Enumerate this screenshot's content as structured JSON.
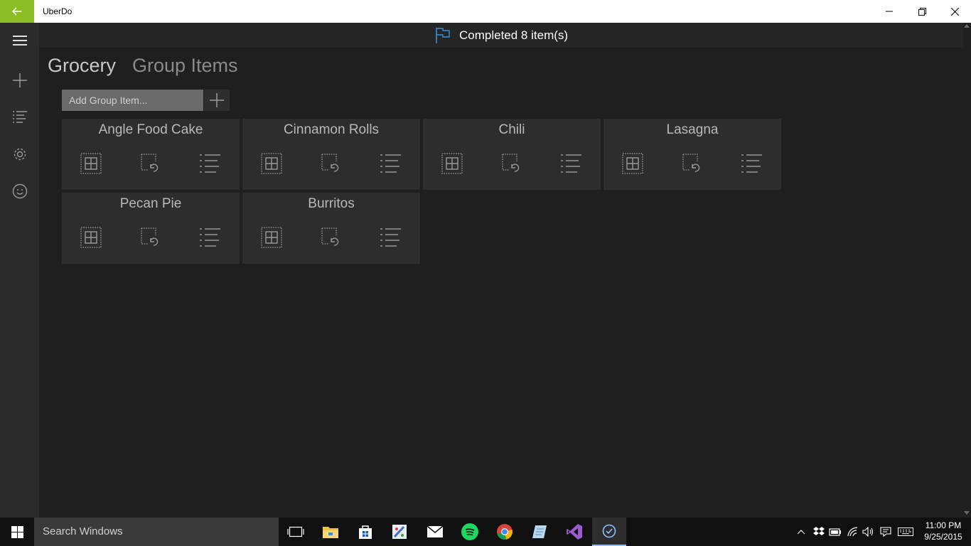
{
  "window": {
    "title": "UberDo",
    "back_icon": "back-arrow-icon",
    "controls": [
      "minimize-icon",
      "restore-icon",
      "close-icon"
    ]
  },
  "colors": {
    "accent_green": "#8cbf26",
    "flag_blue": "#3a8fd9",
    "background": "#1f1f1f",
    "sidebar": "#2b2b2b",
    "tile": "#2d2d2d"
  },
  "sidebar": {
    "items": [
      {
        "icon": "hamburger-menu-icon"
      },
      {
        "icon": "add-icon"
      },
      {
        "icon": "list-icon"
      },
      {
        "icon": "gear-icon"
      },
      {
        "icon": "smiley-icon"
      }
    ]
  },
  "status": {
    "icon": "flag-icon",
    "text": "Completed 8 item(s)"
  },
  "header": {
    "title": "Grocery",
    "subtitle": "Group Items"
  },
  "add_item": {
    "placeholder": "Add Group Item...",
    "button_icon": "plus-icon"
  },
  "groups": [
    {
      "name": "Angle Food Cake"
    },
    {
      "name": "Cinnamon Rolls"
    },
    {
      "name": "Chili"
    },
    {
      "name": "Lasagna"
    },
    {
      "name": "Pecan Pie"
    },
    {
      "name": "Burritos"
    }
  ],
  "tile_actions": [
    "grid-view-icon",
    "undo-select-icon",
    "list-view-icon"
  ],
  "taskbar": {
    "search_text": "Search Windows",
    "apps": [
      "task-view-icon",
      "file-explorer-icon",
      "store-icon",
      "paint-icon",
      "mail-icon",
      "spotify-icon",
      "chrome-icon",
      "notes-icon",
      "visual-studio-icon",
      "uberdo-icon"
    ],
    "tray": [
      "chevron-up-icon",
      "dropbox-icon",
      "battery-icon",
      "wifi-icon",
      "volume-icon",
      "action-center-icon",
      "keyboard-icon"
    ],
    "time": "11:00 PM",
    "date": "9/25/2015"
  }
}
